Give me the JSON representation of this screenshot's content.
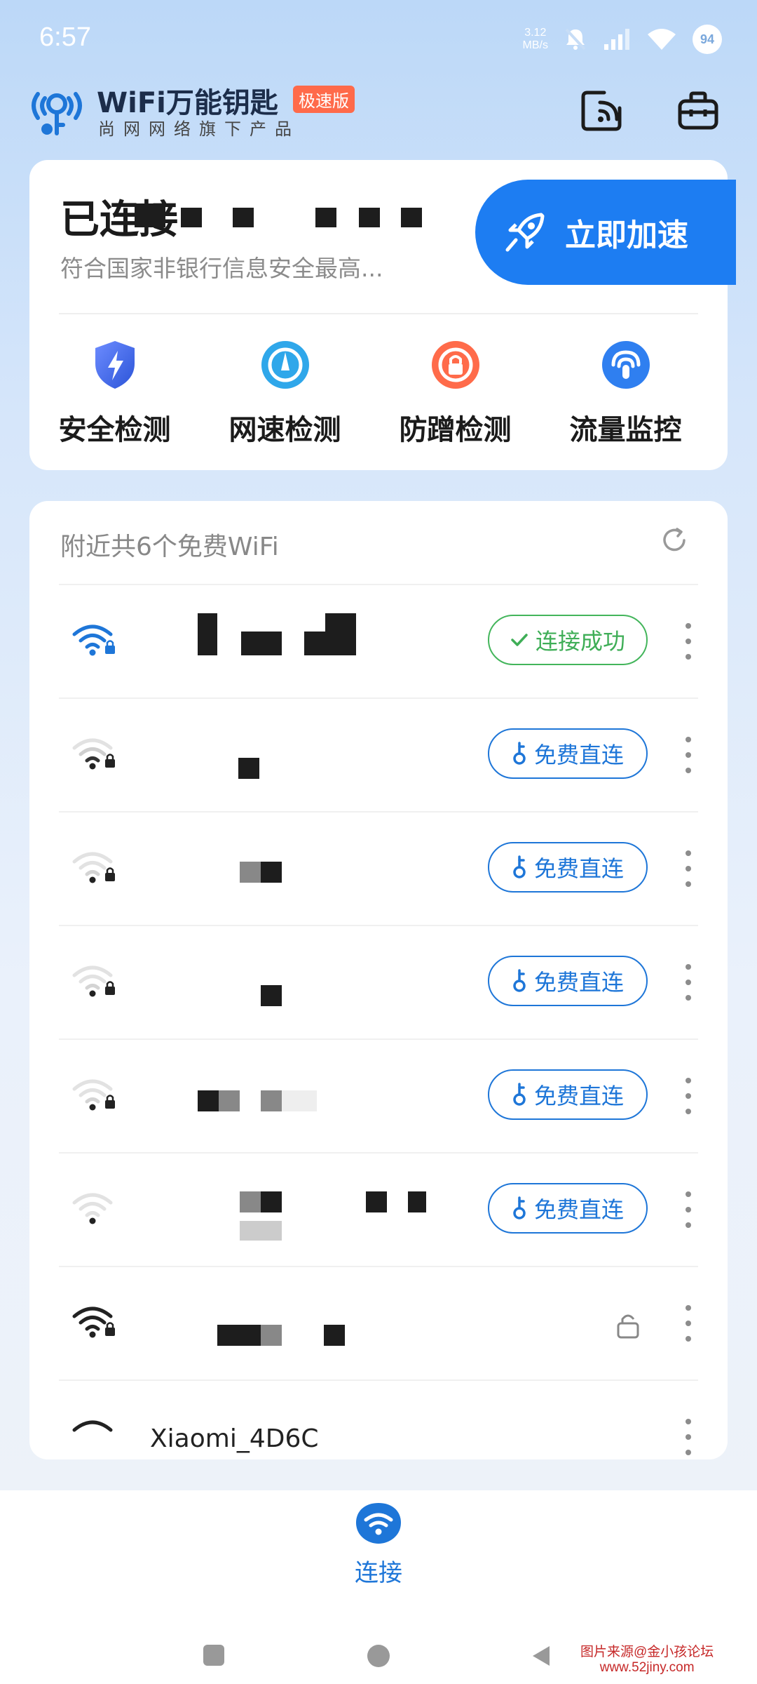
{
  "status_bar": {
    "time": "6:57",
    "net_speed_value": "3.12",
    "net_speed_unit": "MB/s",
    "battery": "94"
  },
  "header": {
    "brand_name": "WiFi万能钥匙",
    "brand_badge": "极速版",
    "brand_sub": "尚网网络旗下产品"
  },
  "connected_card": {
    "title": "已连接",
    "description": "符合国家非银行信息安全最高...",
    "boost_label": "立即加速",
    "tools": [
      {
        "label": "安全检测",
        "icon": "shield-icon"
      },
      {
        "label": "网速检测",
        "icon": "speedometer-icon"
      },
      {
        "label": "防蹭检测",
        "icon": "anti-leech-icon"
      },
      {
        "label": "流量监控",
        "icon": "traffic-monitor-icon"
      }
    ]
  },
  "nearby": {
    "header": "附近共6个免费WiFi",
    "networks": [
      {
        "status": "连接成功",
        "type": "connected"
      },
      {
        "status": "免费直连",
        "type": "free"
      },
      {
        "status": "免费直连",
        "type": "free"
      },
      {
        "status": "免费直连",
        "type": "free"
      },
      {
        "status": "免费直连",
        "type": "free"
      },
      {
        "status": "免费直连",
        "type": "free"
      },
      {
        "status": "",
        "type": "locked"
      },
      {
        "ssid": "Xiaomi_4D6C",
        "status": "",
        "type": "locked"
      }
    ]
  },
  "bottom_nav": {
    "connect_label": "连接"
  },
  "watermark": {
    "line1": "图片来源@金小孩论坛",
    "line2": "www.52jiny.com"
  },
  "colors": {
    "accent": "#1e76d8",
    "success": "#3fae57",
    "badge": "#ff6a4a"
  }
}
